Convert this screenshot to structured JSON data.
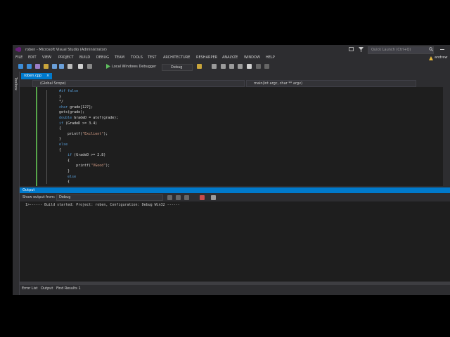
{
  "window": {
    "title": "roben - Microsoft Visual Studio (Administrator)",
    "quick_launch_placeholder": "Quick Launch (Ctrl+Q)"
  },
  "menu": [
    "FILE",
    "EDIT",
    "VIEW",
    "PROJECT",
    "BUILD",
    "DEBUG",
    "TEAM",
    "TOOLS",
    "TEST",
    "ARCHITECTURE",
    "RESHARPER",
    "ANALYZE",
    "WINDOW",
    "HELP"
  ],
  "user": "andrew",
  "toolbar": {
    "debugger_label": "Local Windows Debugger",
    "config_label": "Debug"
  },
  "side_toolbox": "Toolbox",
  "tab": {
    "label": "roben.cpp"
  },
  "nav": {
    "scope": "(Global Scope)",
    "member": "main(int argc, char ** argv)"
  },
  "code_lines": [
    "    #if false",
    "    }",
    "    */",
    "    char grade[127];",
    "    gets(grade);",
    "    double GradeD = atof(grade);",
    "    if (GradeD >= 3.4)",
    "    {",
    "        printf(\"Exclient\");",
    "    }",
    "    else",
    "    {",
    "        if (GradeD >= 2.8)",
    "        {",
    "            printf(\"VGood\");",
    "        }",
    "        else",
    "        {"
  ],
  "output": {
    "title": "Output",
    "show_from_label": "Show output from:",
    "source": "Debug",
    "lines": [
      "1>------ Build started: Project: roben, Configuration: Debug Win32 ------"
    ]
  },
  "bottom_tabs": [
    "Error List",
    "Output",
    "Find Results 1"
  ],
  "colors": {
    "accent": "#007acc",
    "chrome": "#2d2d30",
    "editor_bg": "#1e1e1e",
    "keyword": "#569cd6",
    "string": "#d69d85"
  }
}
